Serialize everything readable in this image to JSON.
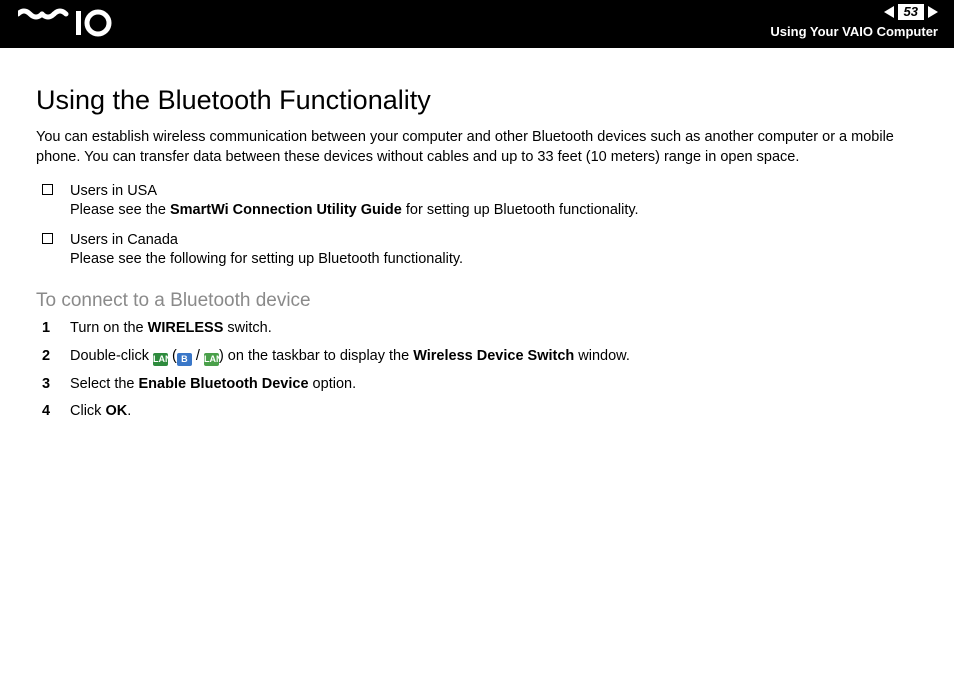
{
  "header": {
    "logo_text": "VAIO",
    "page_number": "53",
    "section": "Using Your VAIO Computer"
  },
  "page": {
    "title": "Using the Bluetooth Functionality",
    "intro": "You can establish wireless communication between your computer and other Bluetooth devices such as another computer or a mobile phone. You can transfer data between these devices without cables and up to 33 feet (10 meters) range in open space.",
    "bullets": [
      {
        "line1": "Users in USA",
        "line2_pre": "Please see the ",
        "line2_bold": "SmartWi Connection Utility Guide",
        "line2_post": " for setting up Bluetooth functionality."
      },
      {
        "line1": "Users in Canada",
        "line2_pre": "Please see the following for setting up Bluetooth functionality.",
        "line2_bold": "",
        "line2_post": ""
      }
    ],
    "subhead": "To connect to a Bluetooth device",
    "steps": [
      {
        "num": "1",
        "pre": "Turn on the ",
        "bold": "WIRELESS",
        "post": " switch."
      },
      {
        "num": "2",
        "pre": "Double-click ",
        "mid1": " (",
        "mid2": " / ",
        "mid3": ") on the taskbar to display the ",
        "bold": "Wireless Device Switch",
        "post": " window."
      },
      {
        "num": "3",
        "pre": "Select the ",
        "bold": "Enable Bluetooth Device",
        "post": " option."
      },
      {
        "num": "4",
        "pre": "Click ",
        "bold": "OK",
        "post": "."
      }
    ],
    "icons": {
      "taskbar1_label": "LAN",
      "taskbar2_label": "B",
      "taskbar3_label": "LAN"
    }
  }
}
